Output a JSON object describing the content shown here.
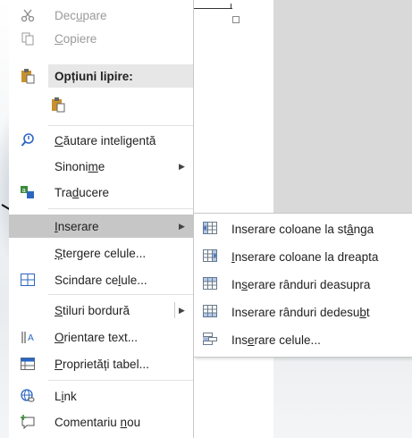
{
  "context_menu": {
    "items": {
      "cut": {
        "before": "Dec",
        "key": "u",
        "after": "pare"
      },
      "copy": {
        "before": "",
        "key": "C",
        "after": "opiere"
      },
      "paste_header": "Opțiuni lipire:",
      "smart_lookup": {
        "before": "",
        "key": "C",
        "after": "ăutare inteligentă"
      },
      "synonyms": {
        "before": "Sinoni",
        "key": "m",
        "after": "e"
      },
      "translate": {
        "before": "Tra",
        "key": "d",
        "after": "ucere"
      },
      "insert": {
        "before": "",
        "key": "I",
        "after": "nserare"
      },
      "delete_cells": {
        "before": "",
        "key": "Ș",
        "after": "tergere celule..."
      },
      "split_cells": {
        "before": "Scindare ce",
        "key": "l",
        "after": "ule..."
      },
      "border_styles": {
        "before": "",
        "key": "S",
        "after": "tiluri bordură"
      },
      "text_direction": {
        "before": "",
        "key": "O",
        "after": "rientare text..."
      },
      "table_properties": {
        "before": "",
        "key": "P",
        "after": "roprietăți tabel..."
      },
      "link": {
        "before": "L",
        "key": "i",
        "after": "nk"
      },
      "new_comment": {
        "before": "Comentariu ",
        "key": "n",
        "after": "ou"
      }
    }
  },
  "insert_submenu": {
    "items": [
      {
        "before": "Inserare coloane la st",
        "key": "â",
        "after": "nga"
      },
      {
        "before": "",
        "key": "I",
        "after": "nserare coloane la dreapta"
      },
      {
        "before": "In",
        "key": "s",
        "after": "erare rânduri deasupra"
      },
      {
        "before": "Inserare rânduri dedesu",
        "key": "b",
        "after": "t"
      },
      {
        "before": "Ins",
        "key": "e",
        "after": "rare celule..."
      }
    ]
  },
  "colors": {
    "highlight": "#c6c6c6",
    "paste_header_bg": "#e7e7e7",
    "icon_blue": "#2b66c2",
    "icon_green": "#3c8a3c",
    "icon_gold": "#c8922a"
  }
}
